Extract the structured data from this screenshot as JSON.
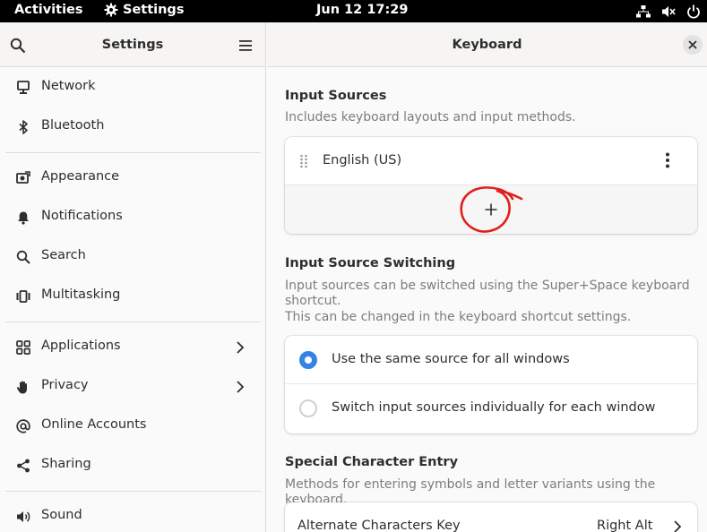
{
  "topbar": {
    "activities": "Activities",
    "app_name": "Settings",
    "clock": "Jun 12  17:29",
    "tray_icons": [
      "network-wired-icon",
      "volume-muted-icon",
      "power-icon"
    ]
  },
  "sidebar": {
    "title": "Settings",
    "groups": [
      [
        {
          "label": "Network",
          "icon": "network-icon"
        },
        {
          "label": "Bluetooth",
          "icon": "bluetooth-icon"
        }
      ],
      [
        {
          "label": "Appearance",
          "icon": "appearance-icon"
        },
        {
          "label": "Notifications",
          "icon": "bell-icon"
        },
        {
          "label": "Search",
          "icon": "search-icon"
        },
        {
          "label": "Multitasking",
          "icon": "multitasking-icon"
        }
      ],
      [
        {
          "label": "Applications",
          "icon": "applications-icon",
          "has_submenu": true
        },
        {
          "label": "Privacy",
          "icon": "hand-icon",
          "has_submenu": true
        },
        {
          "label": "Online Accounts",
          "icon": "at-icon"
        },
        {
          "label": "Sharing",
          "icon": "share-icon"
        }
      ],
      [
        {
          "label": "Sound",
          "icon": "speaker-icon"
        }
      ]
    ]
  },
  "content": {
    "title": "Keyboard",
    "input_sources": {
      "title": "Input Sources",
      "description": "Includes keyboard layouts and input methods.",
      "items": [
        "English (US)"
      ]
    },
    "switching": {
      "title": "Input Source Switching",
      "description_line1": "Input sources can be switched using the Super+Space keyboard",
      "description_line2": "shortcut.",
      "description_line3": "This can be changed in the keyboard shortcut settings.",
      "options": [
        {
          "label": "Use the same source for all windows",
          "selected": true
        },
        {
          "label": "Switch input sources individually for each window",
          "selected": false
        }
      ]
    },
    "special": {
      "title": "Special Character Entry",
      "description": "Methods for entering symbols and letter variants using the keyboard.",
      "alt_key_label": "Alternate Characters Key",
      "alt_key_value": "Right Alt"
    }
  },
  "colors": {
    "accent": "#3584e4",
    "annotation": "#e0201b"
  }
}
